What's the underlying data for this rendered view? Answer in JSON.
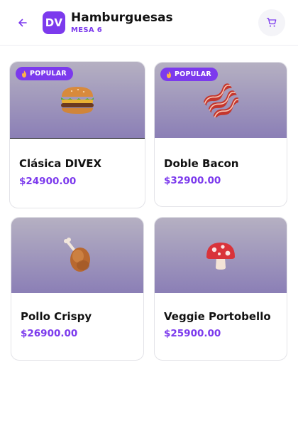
{
  "header": {
    "back_icon": "arrow-left-icon",
    "avatar_initials": "DV",
    "title": "Hamburguesas",
    "subtitle": "MESA 6",
    "cart_icon": "cart-icon",
    "accent_color": "#7c3aed"
  },
  "products": [
    {
      "name": "Clásica DIVEX",
      "price": "$24900.00",
      "badge": "POPULAR",
      "icon": "burger-icon"
    },
    {
      "name": "Doble Bacon",
      "price": "$32900.00",
      "badge": "POPULAR",
      "icon": "bacon-icon"
    },
    {
      "name": "Pollo Crispy",
      "price": "$26900.00",
      "icon": "chicken-leg-icon"
    },
    {
      "name": "Veggie Portobello",
      "price": "$25900.00",
      "icon": "mushroom-icon"
    }
  ]
}
